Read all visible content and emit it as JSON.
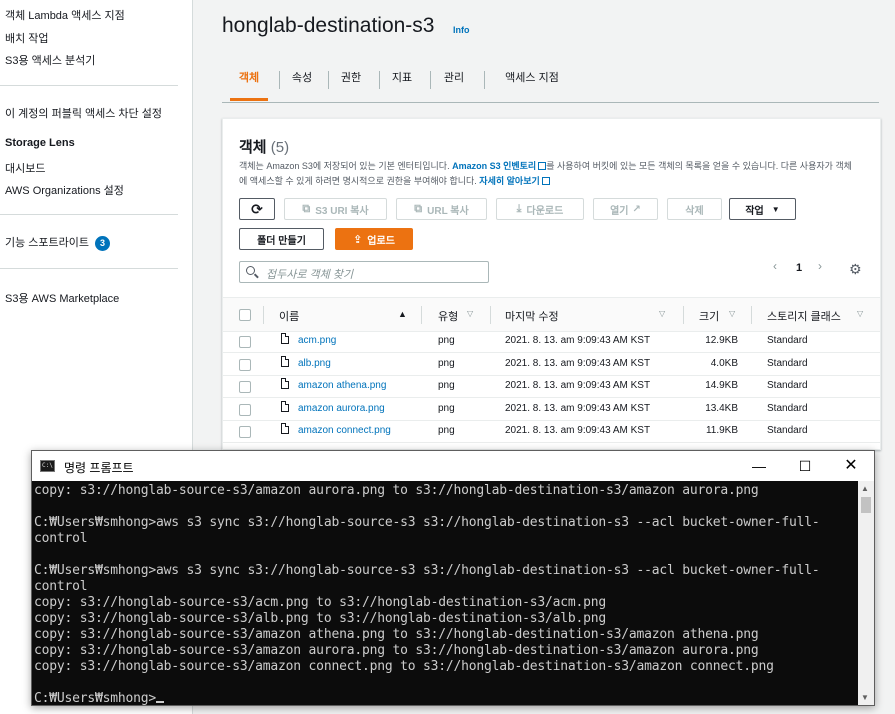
{
  "sidebar": {
    "items": [
      {
        "label": "객체 Lambda 액세스 지점"
      },
      {
        "label": "배치 작업"
      },
      {
        "label": "S3용 액세스 분석기"
      },
      {
        "label": "이 계정의 퍼블릭 액세스 차단 설정"
      },
      {
        "label": "Storage Lens"
      },
      {
        "label": "대시보드"
      },
      {
        "label": "AWS Organizations 설정"
      },
      {
        "label": "기능 스포트라이트"
      },
      {
        "label": "S3용 AWS Marketplace"
      }
    ],
    "spotlight_badge": "3"
  },
  "header": {
    "title": "honglab-destination-s3",
    "info": "Info"
  },
  "tabs": [
    {
      "label": "객체",
      "active": true
    },
    {
      "label": "속성"
    },
    {
      "label": "권한"
    },
    {
      "label": "지표"
    },
    {
      "label": "관리"
    },
    {
      "label": "액세스 지점"
    }
  ],
  "objects_panel": {
    "title": "객체",
    "count": "(5)",
    "desc_part1": "객체는 Amazon S3에 저장되어 있는 기본 엔터티입니다. ",
    "inventory_link": "Amazon S3 인벤토리",
    "desc_part2": "를 사용하여 버킷에 있는 모든 객체의 목록을 얻을 수 있습니다. 다른 사용자가 객체에 액세스할 수 있게 하려면 명시적으로 권한을 부여해야 합니다. ",
    "learn_more": "자세히 알아보기",
    "buttons": {
      "refresh": "⟳",
      "copy_s3_uri": "S3 URI 복사",
      "copy_url": "URL 복사",
      "download": "다운로드",
      "open": "열기",
      "delete": "삭제",
      "actions": "작업",
      "create_folder": "폴더 만들기",
      "upload": "업로드"
    },
    "search_placeholder": "접두사로 객체 찾기",
    "page": "1",
    "columns": {
      "name": "이름",
      "type": "유형",
      "modified": "마지막 수정",
      "size": "크기",
      "storage_class": "스토리지 클래스"
    },
    "rows": [
      {
        "name": "acm.png",
        "type": "png",
        "modified": "2021. 8. 13. am 9:09:43 AM KST",
        "size": "12.9KB",
        "storage": "Standard"
      },
      {
        "name": "alb.png",
        "type": "png",
        "modified": "2021. 8. 13. am 9:09:43 AM KST",
        "size": "4.0KB",
        "storage": "Standard"
      },
      {
        "name": "amazon athena.png",
        "type": "png",
        "modified": "2021. 8. 13. am 9:09:43 AM KST",
        "size": "14.9KB",
        "storage": "Standard"
      },
      {
        "name": "amazon aurora.png",
        "type": "png",
        "modified": "2021. 8. 13. am 9:09:43 AM KST",
        "size": "13.4KB",
        "storage": "Standard"
      },
      {
        "name": "amazon connect.png",
        "type": "png",
        "modified": "2021. 8. 13. am 9:09:43 AM KST",
        "size": "11.9KB",
        "storage": "Standard"
      }
    ]
  },
  "cmd_window": {
    "title": "명령 프롬프트",
    "lines": [
      "copy: s3://honglab-source-s3/amazon aurora.png to s3://honglab-destination-s3/amazon aurora.png",
      "",
      "C:₩Users₩smhong>aws s3 sync s3://honglab-source-s3 s3://honglab-destination-s3 --acl bucket-owner-full-",
      "control",
      "",
      "C:₩Users₩smhong>aws s3 sync s3://honglab-source-s3 s3://honglab-destination-s3 --acl bucket-owner-full-",
      "control",
      "copy: s3://honglab-source-s3/acm.png to s3://honglab-destination-s3/acm.png",
      "copy: s3://honglab-source-s3/alb.png to s3://honglab-destination-s3/alb.png",
      "copy: s3://honglab-source-s3/amazon athena.png to s3://honglab-destination-s3/amazon athena.png",
      "copy: s3://honglab-source-s3/amazon aurora.png to s3://honglab-destination-s3/amazon aurora.png",
      "copy: s3://honglab-source-s3/amazon connect.png to s3://honglab-destination-s3/amazon connect.png",
      "",
      "C:₩Users₩smhong>"
    ]
  },
  "colors": {
    "accent": "#ec7211",
    "link": "#0073bb"
  }
}
